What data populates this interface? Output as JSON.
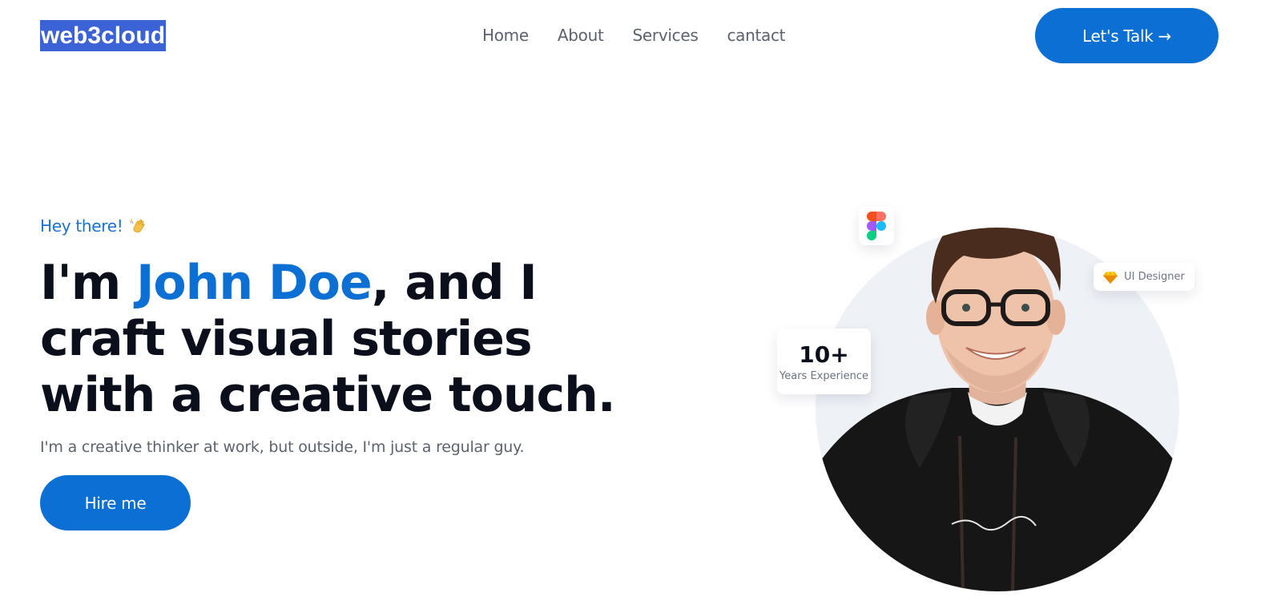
{
  "header": {
    "logo": "web3cloud",
    "nav": [
      "Home",
      "About",
      "Services",
      "cantact"
    ],
    "cta_label": "Let's Talk →"
  },
  "hero": {
    "greeting": "Hey there!",
    "greeting_icon": "waving-hand-icon",
    "headline_prefix": "I'm ",
    "headline_name": "John Doe",
    "headline_suffix": ", and I craft visual stories with a creative touch.",
    "subtitle": "I'm a creative thinker at work, but outside, I'm just a regular guy.",
    "hire_label": "Hire me"
  },
  "badges": {
    "figma_icon": "figma-icon",
    "designer_icon": "sketch-diamond-icon",
    "designer_label": "UI Designer",
    "experience_value": "10+",
    "experience_label": "Years Experience"
  },
  "colors": {
    "accent": "#0b6fd3",
    "logo_bg": "#3b63d6",
    "heading": "#0b0f1c",
    "muted": "#5b6270"
  }
}
